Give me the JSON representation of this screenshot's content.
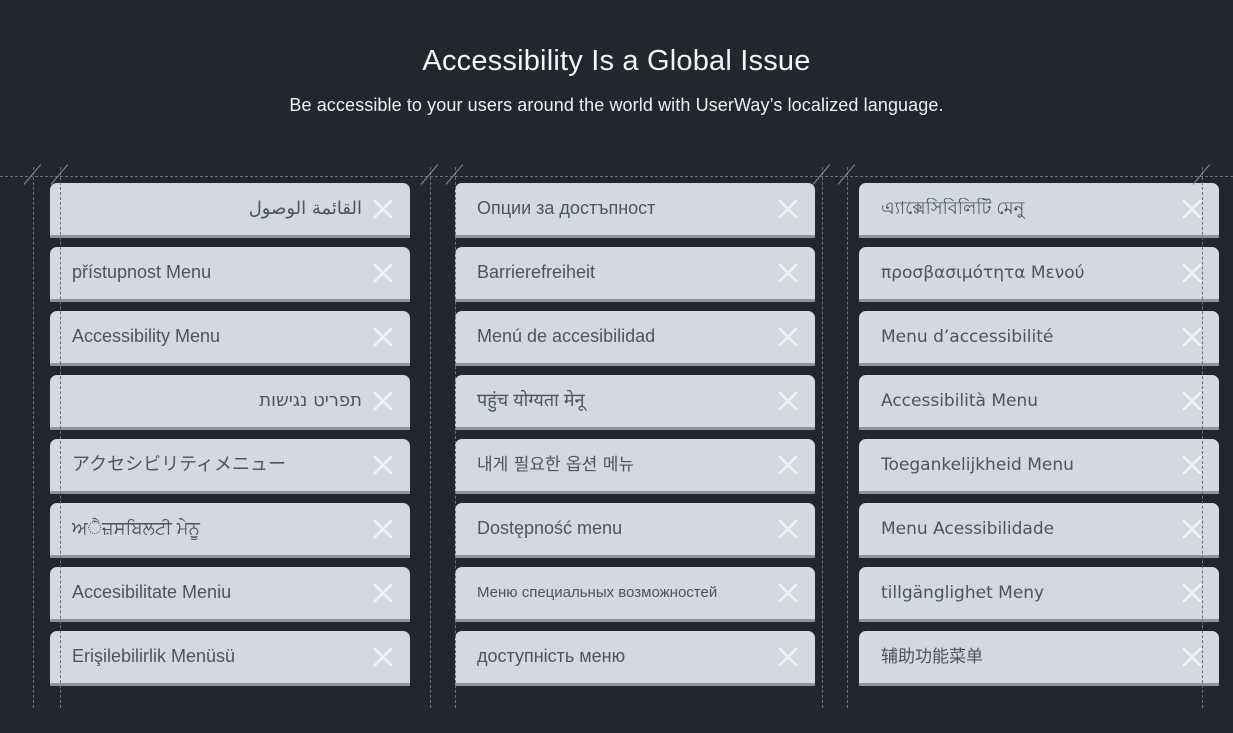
{
  "header": {
    "title": "Accessibility Is a Global Issue",
    "subtitle": "Be accessible to your users around the world with UserWay’s localized language."
  },
  "colors": {
    "background": "#22262e",
    "card_background": "#d3d9de",
    "card_text": "#4b5560",
    "card_shadow": "#8d949b",
    "title_text": "#f4f5f7",
    "guide_line": "#6a717c",
    "close_icon": "#f2f4f6"
  },
  "icons": {
    "close": "close-icon"
  },
  "columns": [
    {
      "name": "column-1",
      "cards": [
        {
          "label": "القائمة الوصول",
          "style": "rtl"
        },
        {
          "label": "přístupnost Menu",
          "style": "default"
        },
        {
          "label": "Accessibility Menu",
          "style": "default"
        },
        {
          "label": "תפריט נגישות",
          "style": "rtl"
        },
        {
          "label": "アクセシビリティメニュー",
          "style": "default"
        },
        {
          "label": "ਅੈਜ਼ਸਬਿਲਟੀ ਮੇਨੂ",
          "style": "default"
        },
        {
          "label": "Accesibilitate Meniu",
          "style": "default"
        },
        {
          "label": "Erişilebilirlik Menüsü",
          "style": "default"
        }
      ]
    },
    {
      "name": "column-2",
      "cards": [
        {
          "label": "Опции за достъпност",
          "style": "default"
        },
        {
          "label": "Barrierefreiheit",
          "style": "default"
        },
        {
          "label": "Menú de accesibilidad",
          "style": "default"
        },
        {
          "label": "पहुंच योग्यता मेनू",
          "style": "default"
        },
        {
          "label": "내게 필요한 옵션 메뉴",
          "style": "serif-cjk"
        },
        {
          "label": "Dostępność menu",
          "style": "default"
        },
        {
          "label": "Меню специальных возможностей",
          "style": "small"
        },
        {
          "label": "доступність меню",
          "style": "default"
        }
      ]
    },
    {
      "name": "column-3",
      "cards": [
        {
          "label": "এ্যাক্সেসিবিলিটি মেনু",
          "style": "default"
        },
        {
          "label": "προσβασιμότητα Μενού",
          "style": "humanist"
        },
        {
          "label": "Menu d’accessibilité",
          "style": "humanist"
        },
        {
          "label": "Accessibilità Menu",
          "style": "humanist"
        },
        {
          "label": "Toegankelijkheid Menu",
          "style": "humanist"
        },
        {
          "label": "Menu Acessibilidade",
          "style": "humanist"
        },
        {
          "label": "tillgänglighet Meny",
          "style": "humanist"
        },
        {
          "label": "辅助功能菜单",
          "style": "serif-cjk"
        }
      ]
    }
  ]
}
